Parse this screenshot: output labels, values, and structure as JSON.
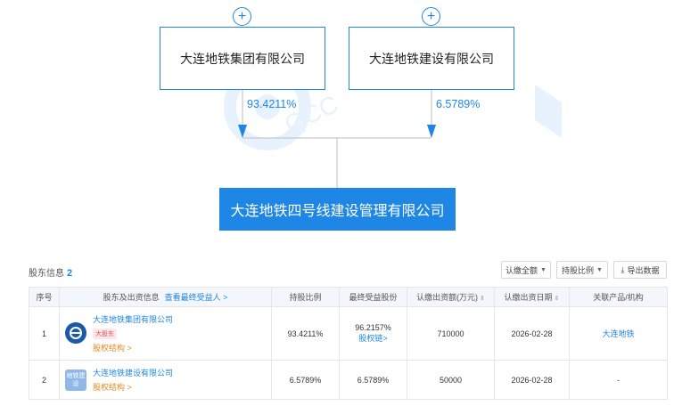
{
  "diagram": {
    "holders": [
      {
        "name": "大连地铁集团有限公司",
        "percent": "93.4211%"
      },
      {
        "name": "大连地铁建设有限公司",
        "percent": "6.5789%"
      }
    ],
    "target_company": "大连地铁四号线建设管理有限公司",
    "expand_symbol": "+",
    "watermark_text": "企查查 QCC"
  },
  "section": {
    "title": "股东信息",
    "count": "2",
    "buttons": {
      "subscribed_all": "认缴全额",
      "holding_ratio": "持股比例",
      "export": "导出数据"
    }
  },
  "table": {
    "headers": {
      "index": "序号",
      "holder": "股东及出资信息",
      "holder_link": "查看最终受益人 >",
      "ratio": "持股比例",
      "final_benefit": "最终受益股份",
      "subscribed_amount": "认缴出资额(万元)",
      "subscribed_date": "认缴出资日期",
      "related": "关联产品/机构"
    },
    "rows": [
      {
        "index": "1",
        "name": "大连地铁集团有限公司",
        "badge": "大股东",
        "equity_link": "股权结构 >",
        "ratio": "93.4211%",
        "final_benefit": "96.2157%",
        "equity_chain": "股权链>",
        "amount": "710000",
        "date": "2026-02-28",
        "related": "大连地铁"
      },
      {
        "index": "2",
        "name": "大连地铁建设有限公司",
        "logo_text": "地铁建设",
        "equity_link": "股权结构 >",
        "ratio": "6.5789%",
        "final_benefit": "6.5789%",
        "amount": "50000",
        "date": "2026-02-28",
        "related": "-"
      }
    ]
  },
  "colors": {
    "accent": "#1e87e6",
    "badge_red": "#e0505a",
    "link_orange": "#e58a1e",
    "header_bg": "#f3f6fa"
  }
}
